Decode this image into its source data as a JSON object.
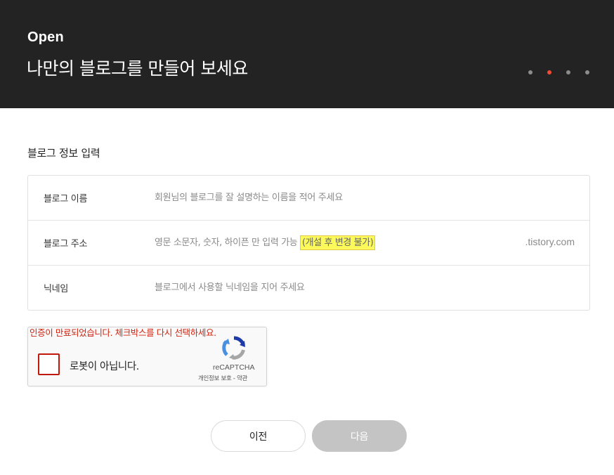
{
  "header": {
    "eyebrow": "Open",
    "title": "나만의 블로그를 만들어 보세요",
    "step_dots": [
      {
        "name": "step-1",
        "active": false
      },
      {
        "name": "step-2",
        "active": true
      },
      {
        "name": "step-3",
        "active": false
      },
      {
        "name": "step-4",
        "active": false
      }
    ],
    "active_dot_color": "#f14b38"
  },
  "section_title": "블로그 정보 입력",
  "form": {
    "blog_name": {
      "label": "블로그 이름",
      "placeholder": "회원님의 블로그를 잘 설명하는 이름을 적어 주세요",
      "value": ""
    },
    "blog_address": {
      "label": "블로그 주소",
      "hint": "영문 소문자, 숫자, 하이픈 만 입력 가능",
      "warning": "(개설 후 변경 불가)",
      "domain_suffix": ".tistory.com",
      "value": ""
    },
    "nickname": {
      "label": "닉네임",
      "placeholder": "블로그에서 사용할 닉네임을 지어 주세요",
      "value": ""
    }
  },
  "recaptcha": {
    "error": "인증이 만료되었습니다. 체크박스를 다시 선택하세요.",
    "label": "로봇이 아닙니다.",
    "brand": "reCAPTCHA",
    "privacy": "개인정보 보호",
    "separator": " - ",
    "terms": "약관",
    "checked": false
  },
  "buttons": {
    "prev": "이전",
    "next": "다음",
    "next_disabled": true
  }
}
